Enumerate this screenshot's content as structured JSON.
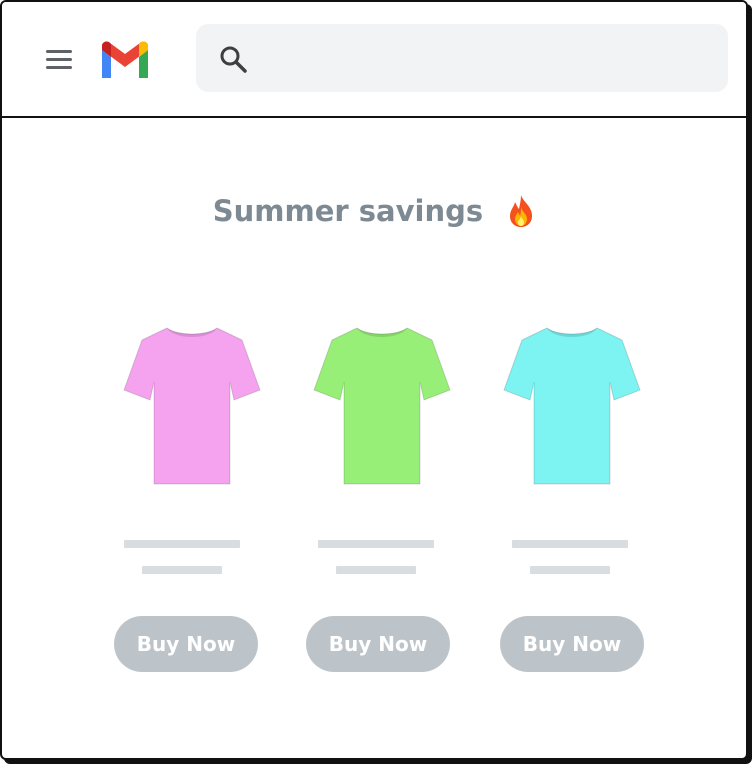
{
  "header": {
    "menu_icon": "hamburger-menu-icon",
    "logo_icon": "gmail-logo-icon",
    "search": {
      "icon": "search-icon",
      "placeholder": "",
      "value": ""
    }
  },
  "email": {
    "headline": "Summer savings",
    "headline_icon": "fire-emoji-icon",
    "products": [
      {
        "shirt_color": "#f5a3ef",
        "button_label": "Buy Now"
      },
      {
        "shirt_color": "#98ef78",
        "button_label": "Buy Now"
      },
      {
        "shirt_color": "#7df3f2",
        "button_label": "Buy Now"
      }
    ]
  },
  "colors": {
    "headline": "#7e8a93",
    "button_bg": "#bdc4c9",
    "placeholder_line": "#d8dde2",
    "search_bg": "#f1f3f4"
  }
}
